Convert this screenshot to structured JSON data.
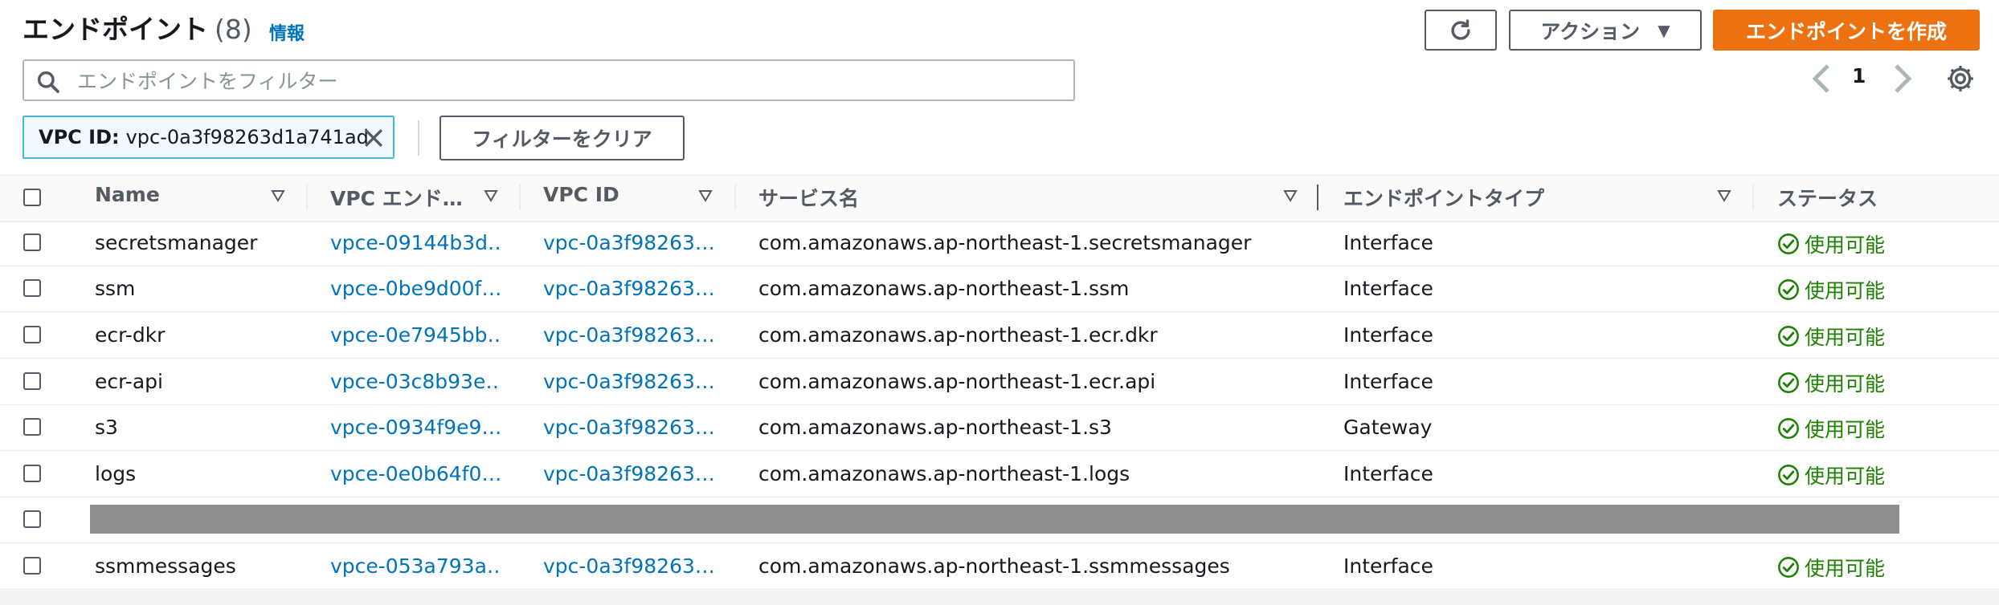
{
  "header": {
    "title": "エンドポイント",
    "count": "(8)",
    "info_link": "情報"
  },
  "toolbar": {
    "refresh_icon": "refresh-icon",
    "actions_label": "アクション",
    "create_label": "エンドポイントを作成"
  },
  "search": {
    "placeholder": "エンドポイントをフィルター",
    "value": ""
  },
  "pagination": {
    "current_page": "1"
  },
  "filter": {
    "chip_key": "VPC ID:",
    "chip_value": "vpc-0a3f98263d1a741ad",
    "clear_label": "フィルターをクリア"
  },
  "table": {
    "columns": [
      "Name",
      "VPC エンド…",
      "VPC ID",
      "サービス名",
      "エンドポイントタイプ",
      "ステータス"
    ],
    "rows": [
      {
        "name": "secretsmanager",
        "endpoint_id": "vpce-09144b3d…",
        "vpc_id": "vpc-0a3f98263…",
        "service": "com.amazonaws.ap-northeast-1.secretsmanager",
        "type": "Interface",
        "status": "使用可能"
      },
      {
        "name": "ssm",
        "endpoint_id": "vpce-0be9d00f…",
        "vpc_id": "vpc-0a3f98263…",
        "service": "com.amazonaws.ap-northeast-1.ssm",
        "type": "Interface",
        "status": "使用可能"
      },
      {
        "name": "ecr-dkr",
        "endpoint_id": "vpce-0e7945bb…",
        "vpc_id": "vpc-0a3f98263…",
        "service": "com.amazonaws.ap-northeast-1.ecr.dkr",
        "type": "Interface",
        "status": "使用可能"
      },
      {
        "name": "ecr-api",
        "endpoint_id": "vpce-03c8b93e…",
        "vpc_id": "vpc-0a3f98263…",
        "service": "com.amazonaws.ap-northeast-1.ecr.api",
        "type": "Interface",
        "status": "使用可能"
      },
      {
        "name": "s3",
        "endpoint_id": "vpce-0934f9e9…",
        "vpc_id": "vpc-0a3f98263…",
        "service": "com.amazonaws.ap-northeast-1.s3",
        "type": "Gateway",
        "status": "使用可能"
      },
      {
        "name": "logs",
        "endpoint_id": "vpce-0e0b64f0…",
        "vpc_id": "vpc-0a3f98263…",
        "service": "com.amazonaws.ap-northeast-1.logs",
        "type": "Interface",
        "status": "使用可能"
      },
      {
        "name": "ssmmessages",
        "endpoint_id": "vpce-053a793a…",
        "vpc_id": "vpc-0a3f98263…",
        "service": "com.amazonaws.ap-northeast-1.ssmmessages",
        "type": "Interface",
        "status": "使用可能"
      }
    ]
  },
  "colors": {
    "primary": "#ec7211",
    "link": "#0073bb",
    "status_ok": "#1d8102",
    "chip_border": "#44b9d6"
  }
}
